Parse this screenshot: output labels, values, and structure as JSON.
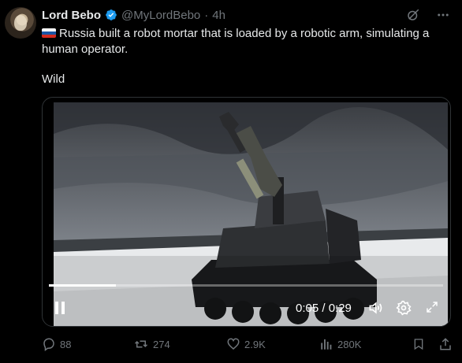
{
  "post": {
    "author_name": "Lord Bebo",
    "handle": "@MyLordBebo",
    "separator": "·",
    "time": "4h",
    "text": "Russia built a robot mortar that is loaded by a robotic arm, simulating a human operator.",
    "text2": "Wild"
  },
  "video": {
    "timecode": "0:05 / 0:29",
    "progress_fraction": 0.17
  },
  "actions": {
    "replies": "88",
    "reposts": "274",
    "likes": "2.9K",
    "views": "280K"
  },
  "colors": {
    "background": "#000000",
    "text": "#e7e9ea",
    "muted": "#71767b",
    "verified": "#1d9bf0"
  }
}
